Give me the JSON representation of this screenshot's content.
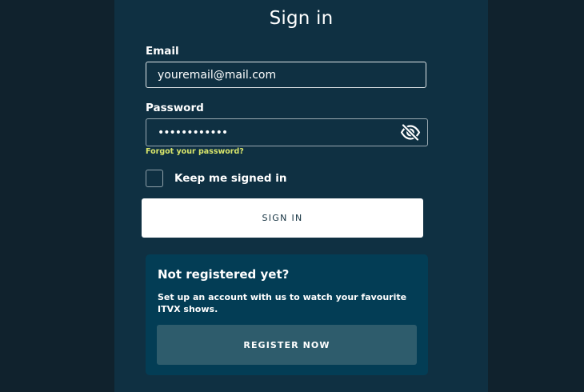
{
  "form": {
    "title": "Sign in",
    "email": {
      "label": "Email",
      "value": "youremail@mail.com"
    },
    "password": {
      "label": "Password",
      "value": "••••••••••••",
      "toggle_icon": "eye-slash-icon"
    },
    "forgot_link": "Forgot your password?",
    "keep_signed_in": {
      "label": "Keep me signed in",
      "checked": false
    },
    "submit_label": "SIGN IN"
  },
  "register": {
    "title": "Not registered yet?",
    "description": "Set up an account with us to watch your favourite ITVX shows.",
    "button_label": "REGISTER NOW"
  },
  "colors": {
    "page_bg": "#10222d",
    "panel_bg": "#0f3042",
    "register_bg": "#033d55",
    "register_button": "#2e5c6c",
    "link": "#d9e66b"
  }
}
